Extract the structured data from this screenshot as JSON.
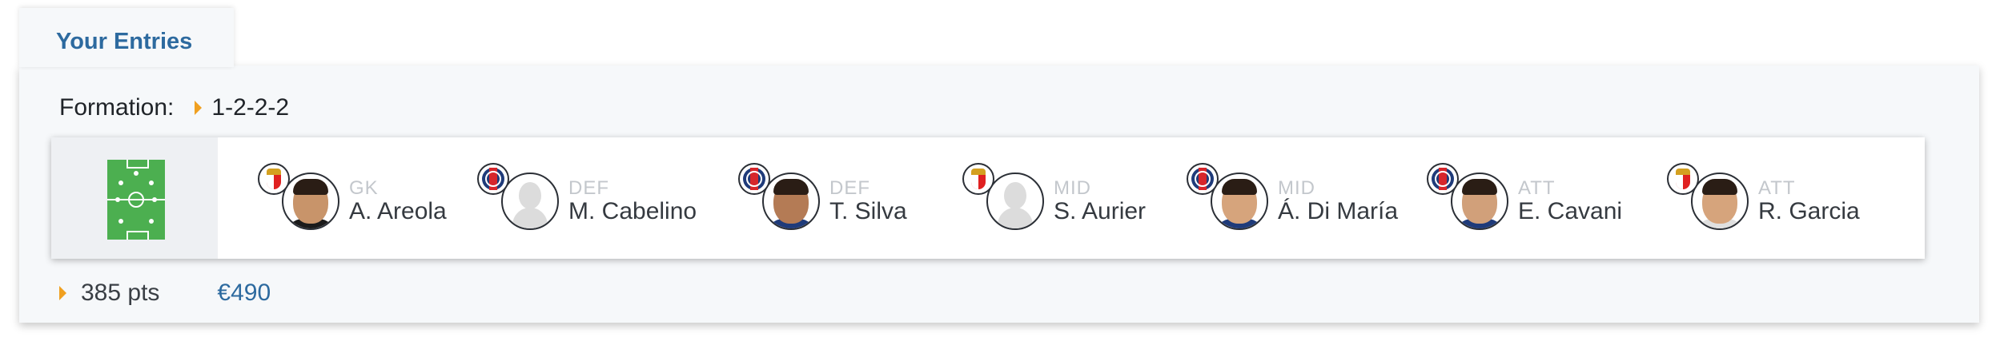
{
  "tabs": {
    "entries_label": "Your Entries"
  },
  "formation": {
    "label": "Formation:",
    "value": "1-2-2-2"
  },
  "lineup": [
    {
      "position": "GK",
      "name": "A. Areola",
      "club": "AS Monaco",
      "photo": "player-photo"
    },
    {
      "position": "DEF",
      "name": "M. Cabelino",
      "club": "PSG",
      "photo": "placeholder"
    },
    {
      "position": "DEF",
      "name": "T. Silva",
      "club": "PSG",
      "photo": "player-photo"
    },
    {
      "position": "MID",
      "name": "S. Aurier",
      "club": "AS Monaco",
      "photo": "placeholder"
    },
    {
      "position": "MID",
      "name": "Á. Di María",
      "club": "PSG",
      "photo": "player-photo"
    },
    {
      "position": "ATT",
      "name": "E. Cavani",
      "club": "PSG",
      "photo": "player-photo"
    },
    {
      "position": "ATT",
      "name": "R. Garcia",
      "club": "AS Monaco",
      "photo": "player-photo"
    }
  ],
  "summary": {
    "points": "385 pts",
    "value": "€490"
  },
  "colors": {
    "accent": "#2d6a9f",
    "caret": "#f0a020",
    "pitch": "#4caf50",
    "psg_blue": "#1f3b7a",
    "monaco_red": "#e02020"
  },
  "icons": {
    "pitch": "soccer-pitch-icon",
    "caret": "caret-right-icon"
  }
}
